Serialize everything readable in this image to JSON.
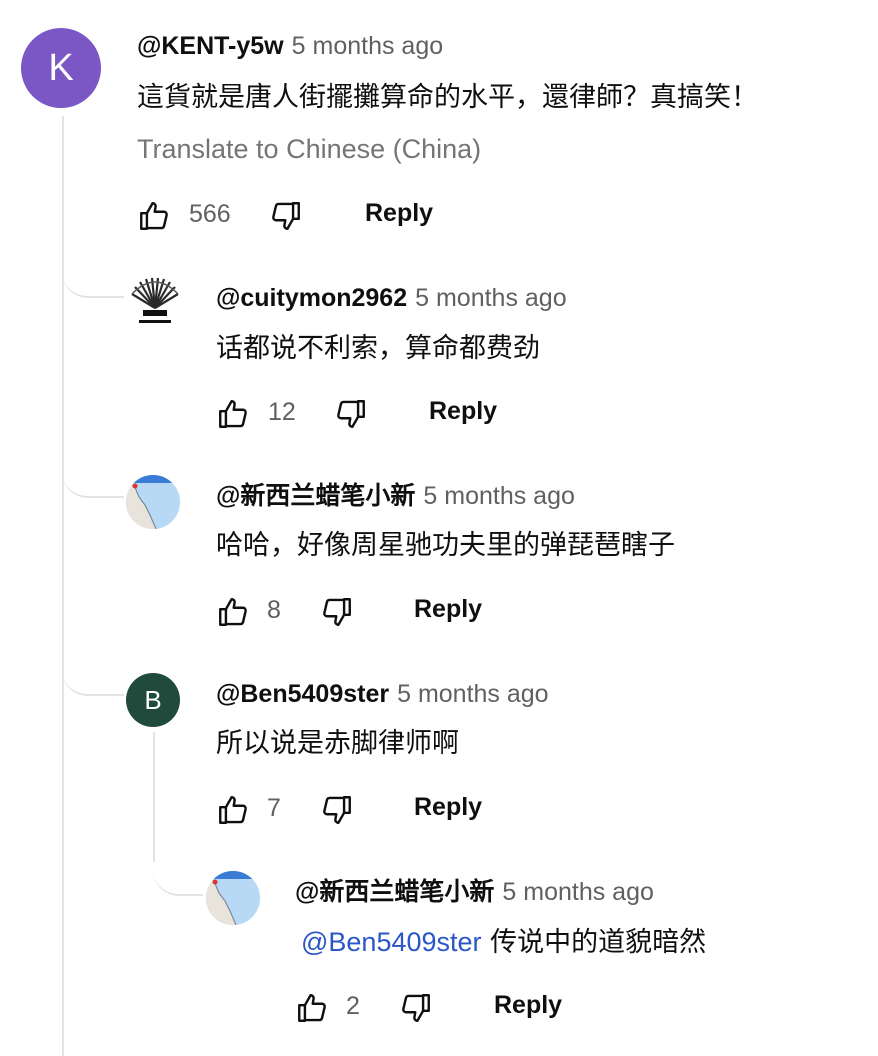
{
  "comments": [
    {
      "author": "@KENT-y5w",
      "time": "5 months ago",
      "text": "這貨就是唐人街擺攤算命的水平，還律師？真搞笑！",
      "translate": "Translate to Chinese (China)",
      "likes": "566",
      "reply": "Reply",
      "avatar_letter": "K",
      "avatar_color": "#7b57c6"
    },
    {
      "author": "@cuitymon2962",
      "time": "5 months ago",
      "text": "话都说不利索，算命都费劲",
      "likes": "12",
      "reply": "Reply"
    },
    {
      "author": "@新西兰蜡笔小新",
      "time": "5 months ago",
      "text": "哈哈，好像周星驰功夫里的弹琵琶瞎子",
      "likes": "8",
      "reply": "Reply"
    },
    {
      "author": "@Ben5409ster",
      "time": "5 months ago",
      "text": "所以说是赤脚律师啊",
      "likes": "7",
      "reply": "Reply",
      "avatar_letter": "B",
      "avatar_color": "#1f4a3c"
    },
    {
      "author": "@新西兰蜡笔小新",
      "time": "5 months ago",
      "mention": "@Ben5409ster",
      "text": " 传说中的道貌暗然",
      "likes": "2",
      "reply": "Reply"
    }
  ],
  "colors": {
    "mention": "#2a56c6",
    "thread_line": "#e3e3e3",
    "muted": "#606060"
  }
}
